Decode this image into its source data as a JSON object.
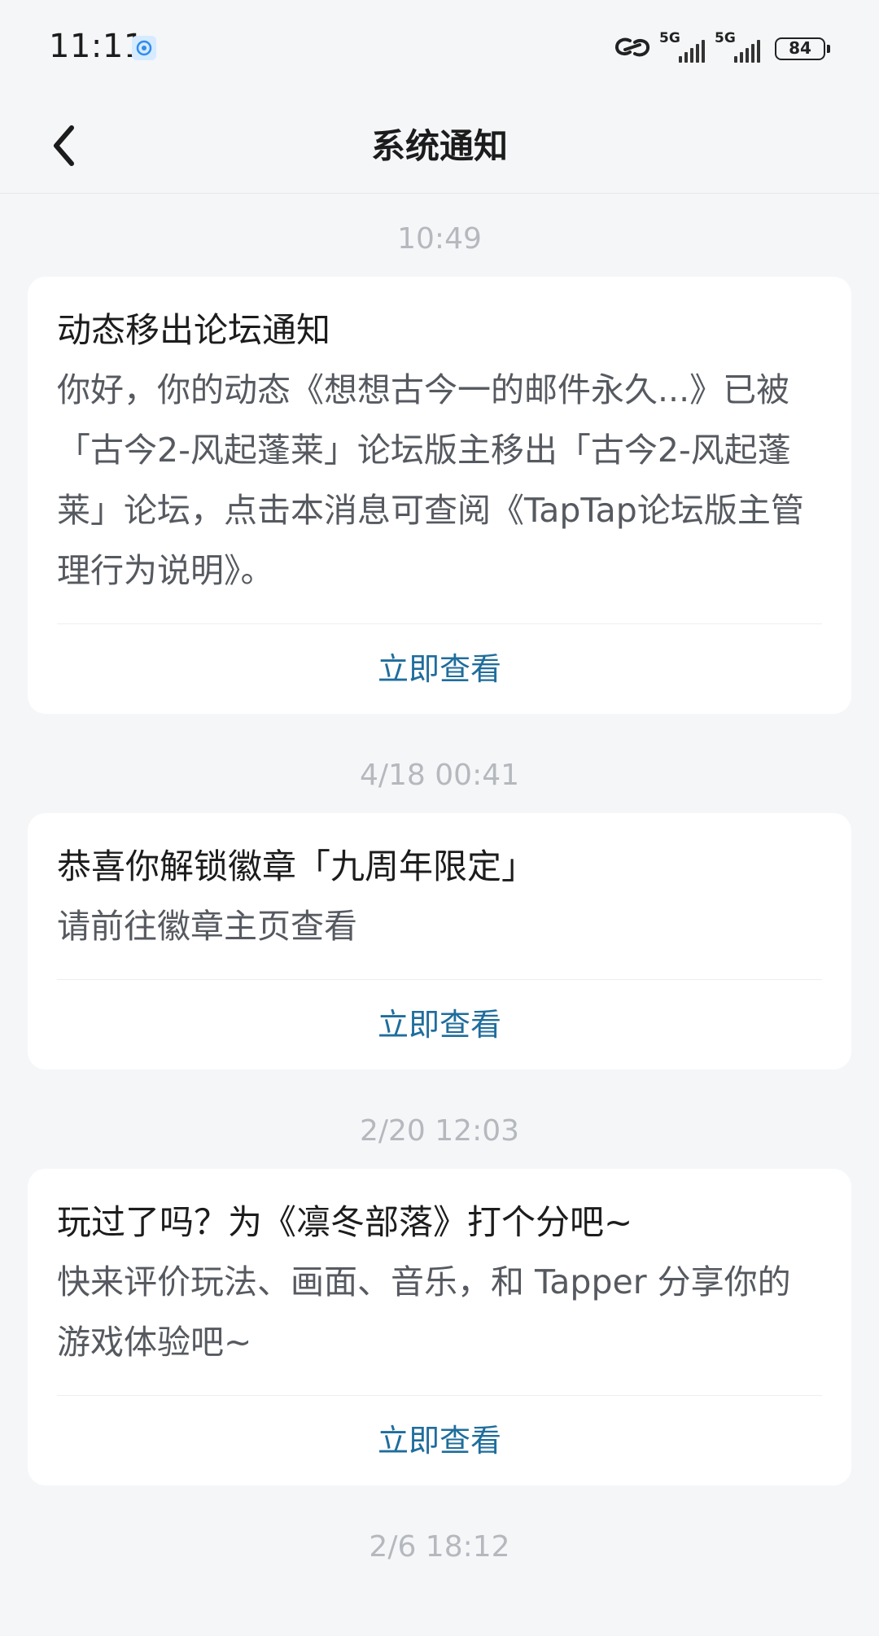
{
  "status_bar": {
    "time": "11:11",
    "network_1": "5G",
    "network_2": "5G",
    "battery": "84"
  },
  "header": {
    "title": "系统通知"
  },
  "notifications": [
    {
      "timestamp": "10:49",
      "title": "动态移出论坛通知",
      "body": "你好，你的动态《想想古今一的邮件永久...》已被「古今2-风起蓬莱」论坛版主移出「古今2-风起蓬莱」论坛，点击本消息可查阅《TapTap论坛版主管理行为说明》。",
      "action": "立即查看"
    },
    {
      "timestamp": "4/18  00:41",
      "title": "恭喜你解锁徽章「九周年限定」",
      "body": "请前往徽章主页查看",
      "action": "立即查看"
    },
    {
      "timestamp": "2/20  12:03",
      "title": "玩过了吗？为《凛冬部落》打个分吧~",
      "body": "快来评价玩法、画面、音乐，和 Tapper 分享你的游戏体验吧~",
      "action": "立即查看"
    },
    {
      "timestamp": "2/6  18:12"
    }
  ]
}
